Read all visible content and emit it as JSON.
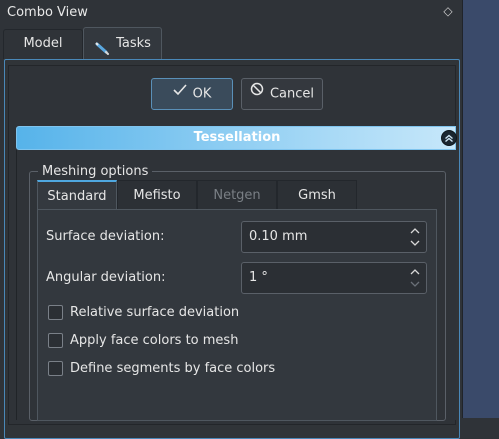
{
  "panel": {
    "title": "Combo View",
    "float_icon": "◇"
  },
  "tabs": [
    {
      "label": "Model"
    },
    {
      "label": "Tasks",
      "icon": "pencil-icon"
    }
  ],
  "buttons": {
    "ok_label": "OK",
    "cancel_label": "Cancel"
  },
  "section": {
    "title": "Tessellation",
    "collapse_icon": "chevron-up-icon"
  },
  "group": {
    "legend": "Meshing options"
  },
  "mesher_tabs": [
    {
      "label": "Standard",
      "active": true
    },
    {
      "label": "Mefisto"
    },
    {
      "label": "Netgen",
      "disabled": true
    },
    {
      "label": "Gmsh"
    }
  ],
  "form": {
    "surface_deviation": {
      "label": "Surface deviation:",
      "value": "0.10 mm"
    },
    "angular_deviation": {
      "label": "Angular deviation:",
      "value": "1 °"
    }
  },
  "checkboxes": [
    {
      "label": "Relative surface deviation",
      "checked": false
    },
    {
      "label": "Apply face colors to mesh",
      "checked": false
    },
    {
      "label": "Define segments by face colors",
      "checked": false
    }
  ],
  "colors": {
    "accent": "#56b3ea",
    "background": "#2f3338",
    "section_header": "#8dcdf3"
  }
}
